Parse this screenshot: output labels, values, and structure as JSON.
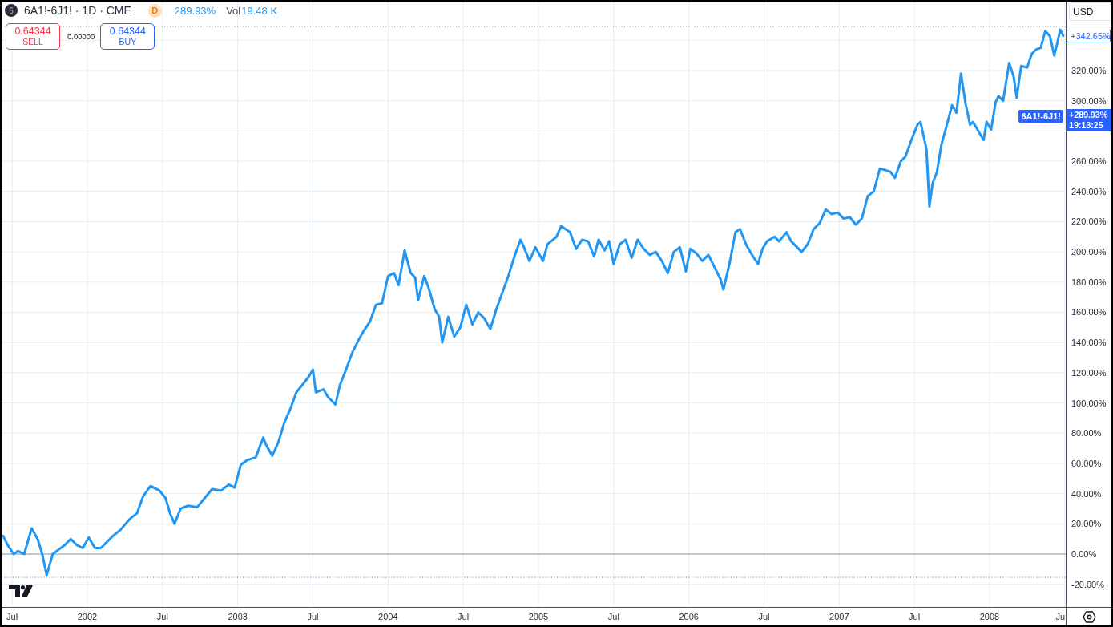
{
  "legend": {
    "symbol_badge": "6",
    "title": "6A1!-6J1! · 1D · CME",
    "status_badge": "D",
    "change": "289.93%",
    "volume_label": "Vol",
    "volume": "19.48 K"
  },
  "order_buttons": [
    {
      "kind": "sell",
      "price": "0.64344",
      "label": "SELL"
    },
    {
      "kind": "buy",
      "price": "0.64344",
      "label": "BUY"
    }
  ],
  "spread": "0.00000",
  "price_axis": {
    "currency": "USD"
  },
  "chart": {
    "chart_data": {
      "type": "line",
      "x": [
        2001.44,
        2001.47,
        2001.51,
        2001.54,
        2001.58,
        2001.63,
        2001.67,
        2001.7,
        2001.73,
        2001.77,
        2001.81,
        2001.85,
        2001.89,
        2001.93,
        2001.97,
        2002.01,
        2002.05,
        2002.09,
        2002.13,
        2002.17,
        2002.22,
        2002.28,
        2002.33,
        2002.37,
        2002.42,
        2002.48,
        2002.52,
        2002.55,
        2002.58,
        2002.62,
        2002.67,
        2002.73,
        2002.78,
        2002.83,
        2002.89,
        2002.94,
        2002.98,
        2003.02,
        2003.06,
        2003.12,
        2003.17,
        2003.19,
        2003.23,
        2003.27,
        2003.31,
        2003.35,
        2003.39,
        2003.43,
        2003.47,
        2003.5,
        2003.52,
        2003.57,
        2003.6,
        2003.65,
        2003.68,
        2003.72,
        2003.76,
        2003.8,
        2003.84,
        2003.88,
        2003.92,
        2003.96,
        2004.0,
        2004.04,
        2004.07,
        2004.11,
        2004.15,
        2004.18,
        2004.2,
        2004.24,
        2004.27,
        2004.31,
        2004.34,
        2004.36,
        2004.4,
        2004.44,
        2004.48,
        2004.52,
        2004.56,
        2004.6,
        2004.64,
        2004.68,
        2004.72,
        2004.76,
        2004.8,
        2004.84,
        2004.88,
        2004.9,
        2004.94,
        2004.98,
        2005.03,
        2005.06,
        2005.12,
        2005.15,
        2005.21,
        2005.25,
        2005.29,
        2005.33,
        2005.37,
        2005.4,
        2005.44,
        2005.47,
        2005.5,
        2005.54,
        2005.58,
        2005.62,
        2005.66,
        2005.7,
        2005.74,
        2005.78,
        2005.82,
        2005.86,
        2005.9,
        2005.94,
        2005.98,
        2006.01,
        2006.05,
        2006.09,
        2006.13,
        2006.16,
        2006.21,
        2006.23,
        2006.27,
        2006.31,
        2006.34,
        2006.38,
        2006.42,
        2006.46,
        2006.49,
        2006.52,
        2006.57,
        2006.6,
        2006.65,
        2006.68,
        2006.72,
        2006.75,
        2006.79,
        2006.83,
        2006.87,
        2006.91,
        2006.95,
        2006.99,
        2007.03,
        2007.07,
        2007.11,
        2007.15,
        2007.19,
        2007.23,
        2007.27,
        2007.31,
        2007.34,
        2007.37,
        2007.41,
        2007.44,
        2007.48,
        2007.52,
        2007.54,
        2007.58,
        2007.6,
        2007.62,
        2007.65,
        2007.68,
        2007.71,
        2007.75,
        2007.78,
        2007.81,
        2007.84,
        2007.87,
        2007.89,
        2007.93,
        2007.96,
        2007.98,
        2008.01,
        2008.04,
        2008.06,
        2008.09,
        2008.13,
        2008.16,
        2008.18,
        2008.21,
        2008.25,
        2008.28,
        2008.31,
        2008.34,
        2008.37,
        2008.4,
        2008.43,
        2008.45,
        2008.47,
        2008.49
      ],
      "series": [
        {
          "name": "6A1!-6J1!",
          "color": "#2196f3",
          "values": [
            12,
            6,
            0,
            2,
            0,
            17,
            10,
            0,
            -14,
            0,
            3,
            6,
            10,
            6,
            4,
            11,
            4,
            4,
            8,
            12,
            16,
            23,
            27,
            38,
            45,
            42,
            37,
            27,
            20,
            30,
            32,
            31,
            37,
            43,
            42,
            46,
            44,
            59,
            62,
            64,
            77,
            72,
            65,
            74,
            87,
            96,
            107,
            112,
            117,
            122,
            107,
            109,
            104,
            99,
            112,
            122,
            133,
            141,
            148,
            154,
            165,
            166,
            184,
            186,
            178,
            201,
            186,
            183,
            168,
            184,
            176,
            162,
            157,
            140,
            157,
            144,
            150,
            165,
            152,
            160,
            156,
            149,
            162,
            173,
            184,
            197,
            208,
            204,
            194,
            203,
            194,
            205,
            210,
            217,
            213,
            202,
            208,
            207,
            197,
            208,
            201,
            207,
            192,
            205,
            208,
            196,
            208,
            202,
            198,
            200,
            194,
            186,
            200,
            203,
            187,
            202,
            199,
            194,
            198,
            192,
            182,
            175,
            192,
            213,
            215,
            205,
            198,
            192,
            202,
            207,
            210,
            207,
            213,
            207,
            203,
            200,
            205,
            215,
            219,
            228,
            225,
            226,
            222,
            223,
            218,
            222,
            237,
            240,
            255,
            254,
            253,
            249,
            260,
            263,
            274,
            284,
            286,
            268,
            230,
            245,
            253,
            271,
            282,
            297,
            292,
            318,
            298,
            284,
            286,
            279,
            274,
            286,
            281,
            299,
            303,
            300,
            325,
            316,
            302,
            323,
            322,
            331,
            334,
            335,
            346,
            343,
            330,
            338,
            347,
            343
          ]
        }
      ],
      "xlim": [
        2001.43,
        2008.81
      ],
      "ylim": [
        -35,
        365.6
      ],
      "xticks": [
        {
          "value": 2001.5,
          "label": "Jul"
        },
        {
          "value": 2002,
          "label": "2002"
        },
        {
          "value": 2002.5,
          "label": "Jul"
        },
        {
          "value": 2003,
          "label": "2003"
        },
        {
          "value": 2003.5,
          "label": "Jul"
        },
        {
          "value": 2004,
          "label": "2004"
        },
        {
          "value": 2004.5,
          "label": "Jul"
        },
        {
          "value": 2005,
          "label": "2005"
        },
        {
          "value": 2005.5,
          "label": "Jul"
        },
        {
          "value": 2006,
          "label": "2006"
        },
        {
          "value": 2006.5,
          "label": "Jul"
        },
        {
          "value": 2007,
          "label": "2007"
        },
        {
          "value": 2007.5,
          "label": "Jul"
        },
        {
          "value": 2008,
          "label": "2008"
        },
        {
          "value": 2008.5,
          "label": "Ju"
        }
      ],
      "yticks": [
        {
          "value": -20,
          "label": "-20.00%"
        },
        {
          "value": 0,
          "label": "0.00%"
        },
        {
          "value": 20,
          "label": "20.00%"
        },
        {
          "value": 40,
          "label": "40.00%"
        },
        {
          "value": 60,
          "label": "60.00%"
        },
        {
          "value": 80,
          "label": "80.00%"
        },
        {
          "value": 100,
          "label": "100.00%"
        },
        {
          "value": 120,
          "label": "120.00%"
        },
        {
          "value": 140,
          "label": "140.00%"
        },
        {
          "value": 160,
          "label": "160.00%"
        },
        {
          "value": 180,
          "label": "180.00%"
        },
        {
          "value": 200,
          "label": "200.00%"
        },
        {
          "value": 220,
          "label": "220.00%"
        },
        {
          "value": 240,
          "label": "240.00%"
        },
        {
          "value": 260,
          "label": "260.00%"
        },
        {
          "value": 300,
          "label": "300.00%"
        },
        {
          "value": 320,
          "label": "320.00%"
        }
      ],
      "grid": true,
      "ref_lines": [
        {
          "axis": "y",
          "value": 349.2
        },
        {
          "axis": "y",
          "value": -15.4
        },
        {
          "axis": "y",
          "value": 0
        }
      ],
      "annotations": [
        "+342.65%",
        "+289.93%",
        "19:13:25"
      ]
    }
  }
}
